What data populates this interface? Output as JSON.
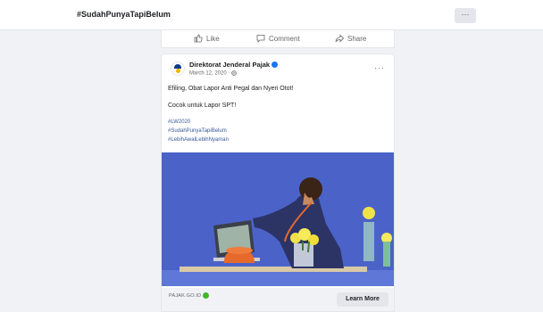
{
  "header": {
    "hashtag": "#SudahPunyaTapiBelum",
    "more_label": "···"
  },
  "prev_post_actions": {
    "like": "Like",
    "comment": "Comment",
    "share": "Share"
  },
  "post": {
    "page_name": "Direktorat Jenderal Pajak",
    "date": "March 12, 2020 ·",
    "more_label": "···",
    "text_line1": "Efiling, Obat Lapor Anti Pegal dan Nyeri Otot!",
    "text_line2": "Cocok untuk Lapor SPT!",
    "hashtags": [
      "#LW2020",
      "#SudahPunyaTapiBelum",
      "#LebihAwalLebihNyaman"
    ],
    "sponsor_label": "PAJAK.GO.ID",
    "cta_label": "Learn More"
  },
  "colors": {
    "link": "#385898",
    "verified": "#1877f2",
    "background": "#f0f2f5",
    "image_bg": "#4b63c9"
  }
}
